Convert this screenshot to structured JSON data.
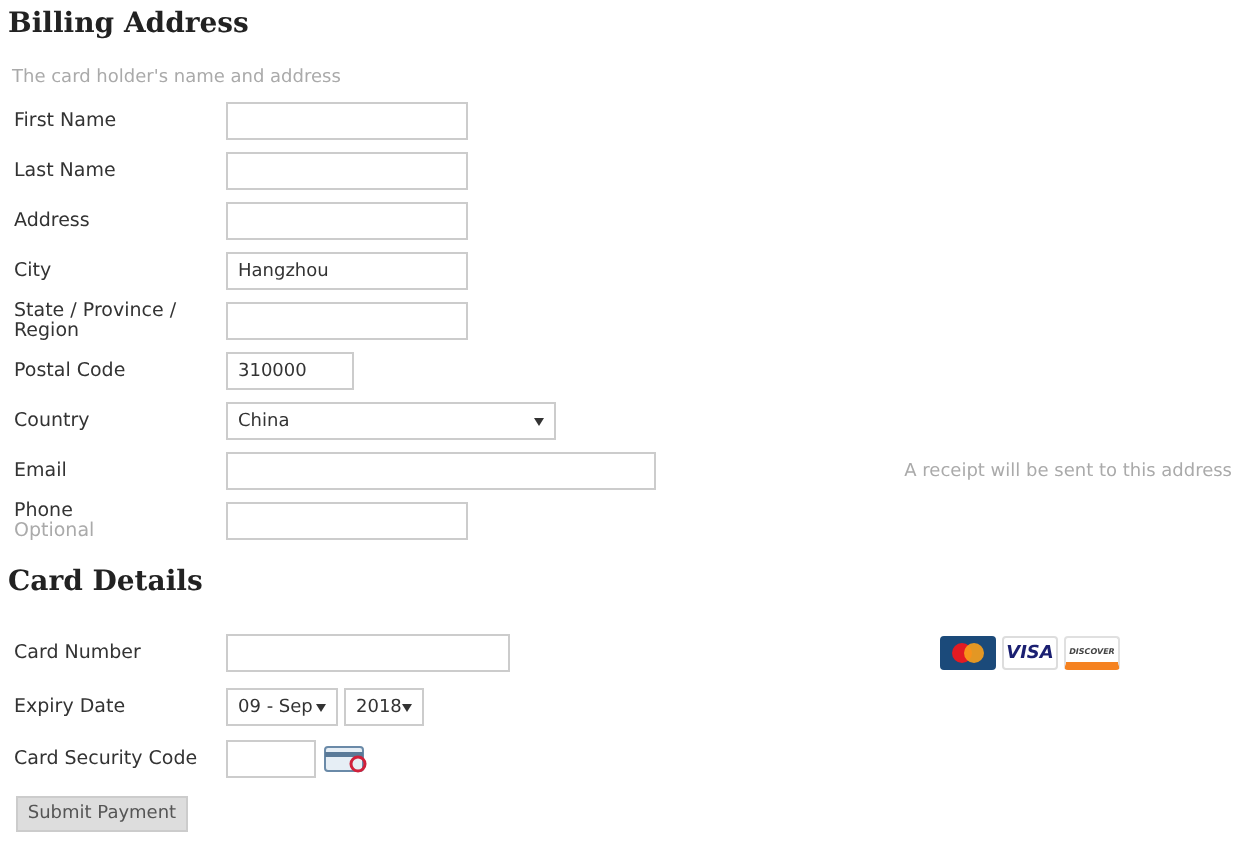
{
  "billing": {
    "title": "Billing Address",
    "subtitle": "The card holder's name and address",
    "fields": [
      {
        "kind": "text",
        "label": "First Name"
      },
      {
        "kind": "text",
        "label": "Last Name"
      },
      {
        "kind": "text",
        "label": "Address"
      },
      {
        "kind": "text",
        "label": "City",
        "value": "Hangzhou"
      },
      {
        "kind": "text",
        "label": "State / Province / Region"
      },
      {
        "kind": "postal",
        "label": "Postal Code",
        "value": "310000"
      },
      {
        "kind": "select",
        "label": "Country",
        "value": "China"
      },
      {
        "kind": "email",
        "label": "Email",
        "hint": "A receipt will be sent to this address"
      },
      {
        "kind": "text",
        "label": "Phone",
        "note": "Optional"
      }
    ]
  },
  "card": {
    "title": "Card Details",
    "logos": [
      {
        "kind": "mastercard"
      },
      {
        "kind": "visa",
        "text": "VISA"
      },
      {
        "kind": "discover",
        "text": "DISCOVER"
      }
    ],
    "number": {
      "label": "Card Number"
    },
    "expiry": {
      "label": "Expiry Date",
      "month": "09 - Sep",
      "year": "2018"
    },
    "security": {
      "label": "Card Security Code"
    },
    "submit": "Submit Payment"
  }
}
